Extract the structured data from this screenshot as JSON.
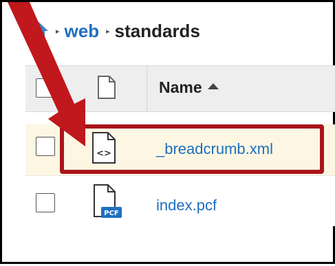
{
  "breadcrumb": {
    "home_icon": "home-icon",
    "separator": "▸",
    "items": [
      {
        "label": "web"
      },
      {
        "label": "standards"
      }
    ]
  },
  "table": {
    "columns": {
      "name_label": "Name",
      "sort": "ascending",
      "type_icon": "document-icon"
    },
    "rows": [
      {
        "name": "_breadcrumb.xml",
        "icon": "xml-file-icon",
        "icon_text": "<>",
        "highlighted": true
      },
      {
        "name": "index.pcf",
        "icon": "pcf-file-icon",
        "icon_text": "PCF",
        "highlighted": false
      }
    ]
  },
  "colors": {
    "link": "#1f6fbf",
    "annotation": "#c0181c",
    "row_highlight": "#fdf6e3"
  }
}
